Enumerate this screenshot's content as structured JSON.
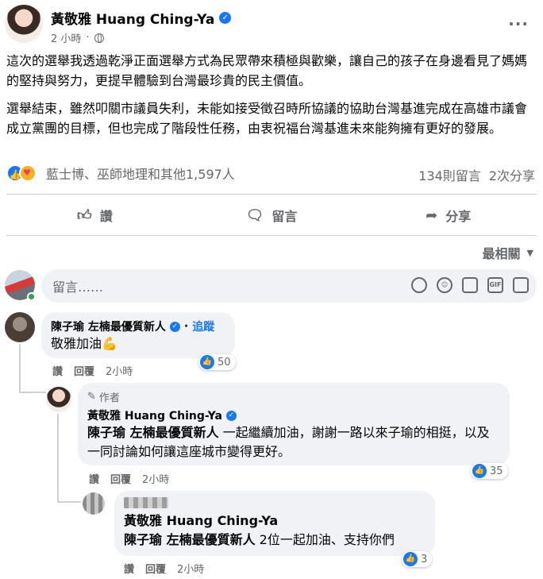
{
  "post": {
    "author": "黃敬雅 Huang Ching-Ya",
    "time": "2 小時",
    "paragraphs": [
      "這次的選舉我透過乾淨正面選舉方式為民眾帶來積極與歡樂，讓自己的孩子在身邊看見了媽媽的堅持與努力，更提早體驗到台灣最珍貴的民主價值。",
      "選舉結束，雖然叩關市議員失利，未能如接受徵召時所協議的協助台灣基進完成在高雄市議會成立黨團的目標，但也完成了階段性任務，由衷祝福台灣基進未來能夠擁有更好的發展。"
    ],
    "reactions_text": "藍士博、巫師地理和其他1,597人",
    "comments_count": "134則留言",
    "shares_count": "2次分享"
  },
  "actions": {
    "like": "讚",
    "comment": "留言",
    "share": "分享"
  },
  "sort_label": "最相關",
  "composer": {
    "placeholder": "留言……"
  },
  "comments": [
    {
      "name": "陳子瑜 左楠最優質新人",
      "follow": "追蹤",
      "text": "敬雅加油💪",
      "like": "讚",
      "reply": "回覆",
      "time": "2小時",
      "reactions": "50"
    },
    {
      "author_tag": "作者",
      "name": "黃敬雅 Huang Ching-Ya",
      "mention": "陳子瑜 左楠最優質新人",
      "text": " 一起繼續加油，謝謝一路以來子瑜的相挺，以及一同討論如何讓這座城市變得更好。",
      "like": "讚",
      "reply": "回覆",
      "time": "2小時",
      "reactions": "35"
    },
    {
      "name": "黃敬雅 Huang Ching-Ya",
      "mention": "陳子瑜 左楠最優質新人",
      "text": " 2位一起加油、支持你們",
      "like": "讚",
      "reply": "回覆",
      "time": "2小時",
      "reactions": "3"
    }
  ],
  "colors": {
    "accent": "#1877f2",
    "secondary_text": "#65676b",
    "bubble": "#f0f2f5"
  }
}
